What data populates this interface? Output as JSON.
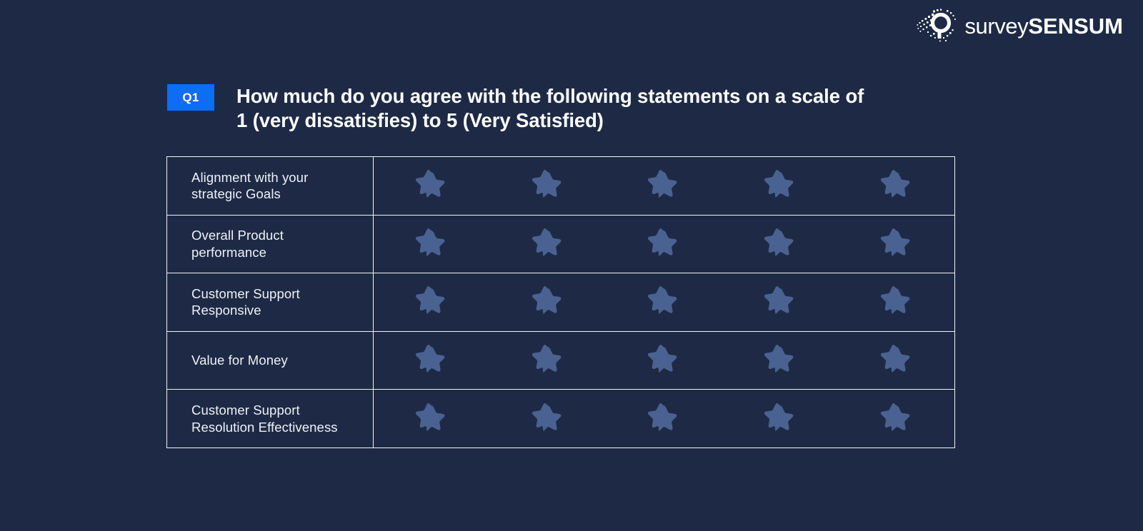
{
  "brand": {
    "logo_icon": "magnifier-pixel-icon",
    "name_light": "survey",
    "name_bold": "SENSUM"
  },
  "question": {
    "badge": "Q1",
    "line1": "How much do you agree with the following statements on a scale of",
    "line2": "1 (very dissatisfies) to 5 (Very Satisfied)",
    "badge_color": "#0b6ef5"
  },
  "matrix": {
    "scale_points": 5,
    "star_icon": "star-icon",
    "star_color": "#4a6291",
    "border_color": "#f2f2f2",
    "background_color": "#1e2a45",
    "rows": [
      {
        "label": "Alignment with your strategic Goals"
      },
      {
        "label": "Overall Product performance"
      },
      {
        "label": "Customer Support Responsive"
      },
      {
        "label": "Value for Money"
      },
      {
        "label": "Customer Support Resolution Effectiveness"
      }
    ]
  }
}
